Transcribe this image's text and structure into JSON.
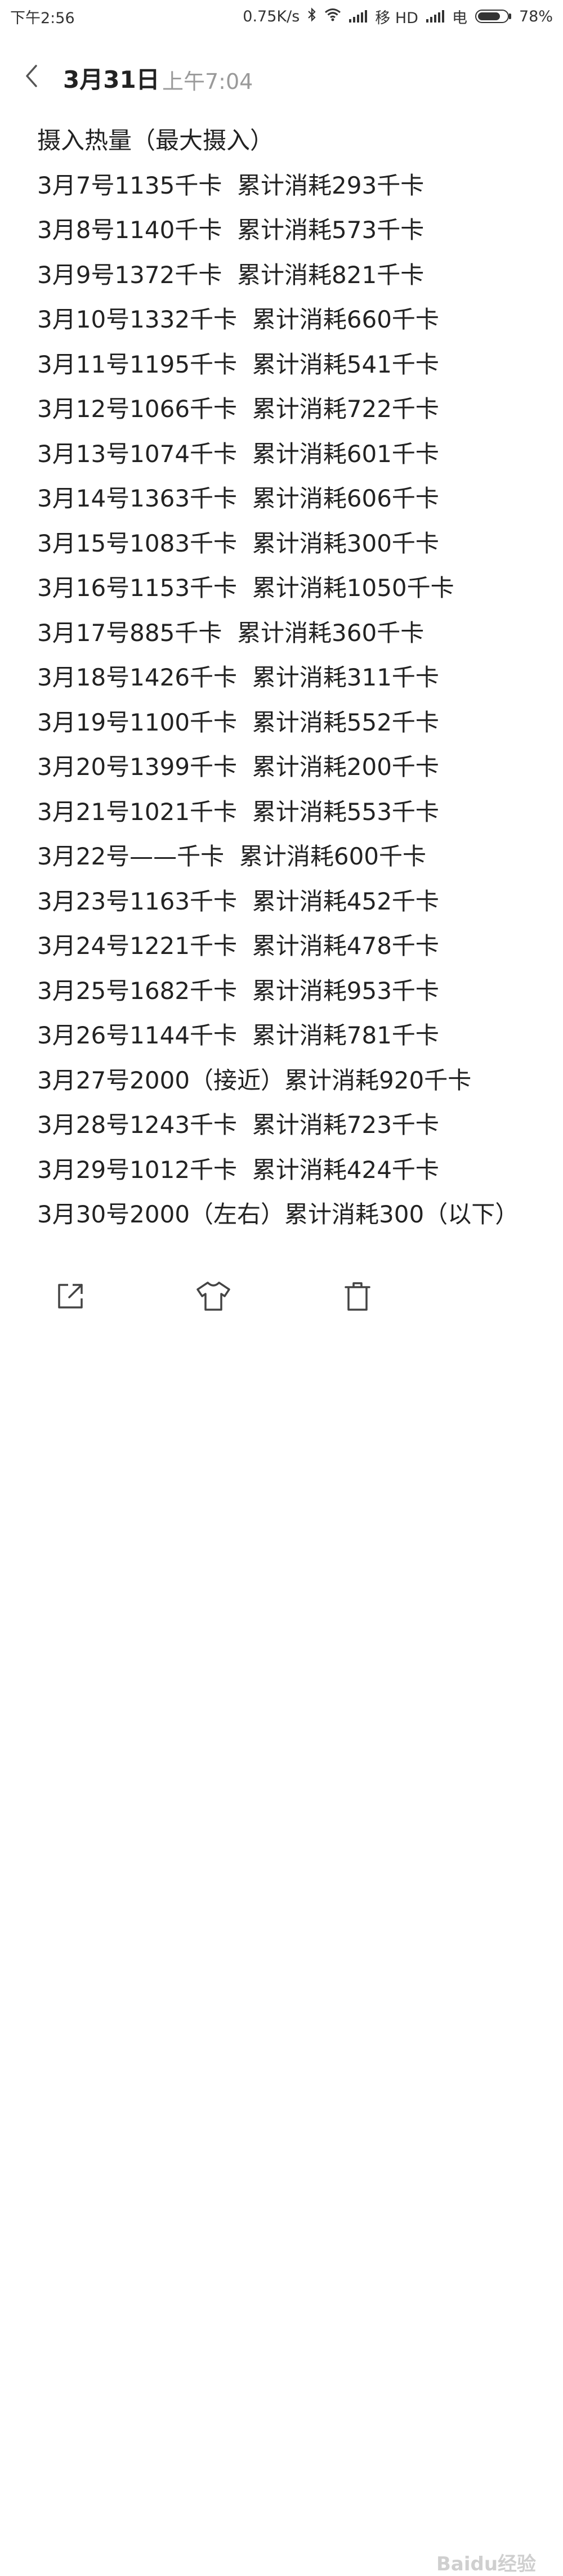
{
  "status_bar": {
    "time": "下午2:56",
    "net_speed": "0.75K/s",
    "carrier1": "移 HD",
    "carrier2": "电",
    "battery_text": "78%",
    "battery_level": 0.78,
    "icons": [
      "bluetooth-icon",
      "wifi-icon",
      "signal-icon",
      "battery-icon"
    ]
  },
  "header": {
    "back_icon": "chevron-left-icon",
    "date": "3月31日",
    "time": "上午7:04"
  },
  "note": {
    "title": "摄入热量（最大摄入）",
    "lines": [
      "3月7号1135千卡  累计消耗293千卡",
      "3月8号1140千卡  累计消耗573千卡",
      "3月9号1372千卡  累计消耗821千卡",
      "3月10号1332千卡  累计消耗660千卡",
      "3月11号1195千卡  累计消耗541千卡",
      "3月12号1066千卡  累计消耗722千卡",
      "3月13号1074千卡  累计消耗601千卡",
      "3月14号1363千卡  累计消耗606千卡",
      "3月15号1083千卡  累计消耗300千卡",
      "3月16号1153千卡  累计消耗1050千卡",
      "3月17号885千卡  累计消耗360千卡",
      "3月18号1426千卡  累计消耗311千卡",
      "3月19号1100千卡  累计消耗552千卡",
      "3月20号1399千卡  累计消耗200千卡",
      "3月21号1021千卡  累计消耗553千卡",
      "3月22号——千卡  累计消耗600千卡",
      "3月23号1163千卡  累计消耗452千卡",
      "3月24号1221千卡  累计消耗478千卡",
      "3月25号1682千卡  累计消耗953千卡",
      "3月26号1144千卡  累计消耗781千卡",
      "3月27号2000（接近）累计消耗920千卡",
      "3月28号1243千卡  累计消耗723千卡",
      "3月29号1012千卡  累计消耗424千卡",
      "3月30号2000（左右）累计消耗300（以下）"
    ]
  },
  "toolbar": {
    "items": [
      "share-icon",
      "shirt-icon",
      "trash-icon"
    ]
  },
  "watermark": "Baidu经验"
}
